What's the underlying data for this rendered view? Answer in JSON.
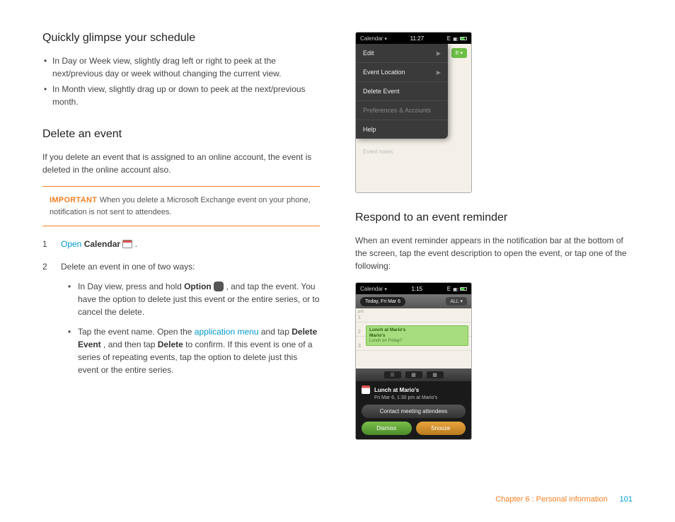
{
  "left": {
    "h1": "Quickly glimpse your schedule",
    "bullets": [
      "In Day or Week view, slightly drag left or right to peek at the next/previous day or week without changing the current view.",
      "In Month view, slightly drag up or down to peek at the next/previous month."
    ],
    "h2": "Delete an event",
    "intro": "If you delete an event that is assigned to an online account, the event is deleted in the online account also.",
    "important_label": "IMPORTANT",
    "important_text": "When you delete a Microsoft Exchange event on your phone, notification is not sent to attendees.",
    "step1": {
      "num": "1",
      "open": "Open",
      "calendar": "Calendar",
      "period": "."
    },
    "step2": {
      "num": "2",
      "text": "Delete an event in one of two ways:",
      "sub": [
        {
          "pre": "In Day view, press and hold ",
          "b1": "Option",
          "mid": ", and tap the event. You have the option to delete just this event or the entire series, or to cancel the delete."
        },
        {
          "pre": "Tap the event name. Open the ",
          "link": "application menu",
          "mid1": " and tap ",
          "b1": "Delete Event",
          "mid2": ", and then tap ",
          "b2": "Delete",
          "mid3": " to confirm. If this event is one of a series of repeating events, tap the option to delete just this event or the entire series."
        }
      ]
    }
  },
  "right": {
    "phone1": {
      "app": "Calendar",
      "time": "11:27",
      "carrier": "E",
      "new": "E ▾",
      "menu": [
        "Edit",
        "Event Location",
        "Delete Event",
        "Preferences & Accounts",
        "Help"
      ],
      "notes": "Event notes"
    },
    "h1": "Respond to an event reminder",
    "intro": "When an event reminder appears in the notification bar at the bottom of the screen, tap the event description to open the event, or tap one of the following:",
    "phone2": {
      "app": "Calendar",
      "time": "1:15",
      "carrier": "E",
      "today": "Today, Fri Mar 6",
      "all": "ALL ▾",
      "hours_label": "pm",
      "hours": [
        "1",
        "2",
        "3"
      ],
      "event_title": "Lunch at Mario's",
      "event_loc": "Mario's",
      "event_q": "Lunch on Friday?",
      "view_icons": [
        "☰",
        "▦",
        "▦"
      ],
      "notif_title": "Lunch at Mario's",
      "notif_sub": "Fri Mar 6, 1:30 pm at Mario's",
      "contact_btn": "Contact meeting attendees",
      "dismiss": "Dismiss",
      "snooze": "Snooze"
    }
  },
  "footer": {
    "chapter": "Chapter 6 : Personal information",
    "page": "101"
  }
}
